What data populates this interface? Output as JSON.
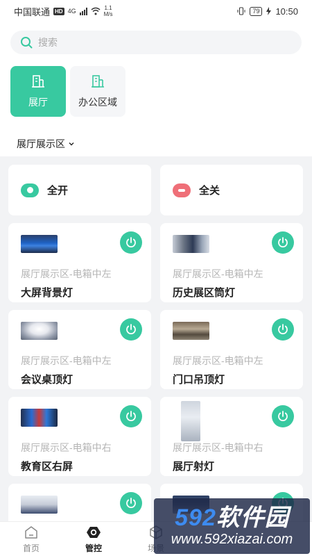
{
  "status_bar": {
    "carrier": "中国联通",
    "network_badge": "HD",
    "net_type": "4G",
    "speed_value": "1.1",
    "speed_unit": "M/s",
    "battery": "79",
    "time": "10:50"
  },
  "search": {
    "placeholder": "搜索",
    "icon": "search-icon"
  },
  "areas": [
    {
      "label": "展厅",
      "icon": "building-icon",
      "active": true
    },
    {
      "label": "办公区域",
      "icon": "building-icon",
      "active": false
    }
  ],
  "zone_selector": {
    "label": "展厅展示区",
    "icon": "chevron-down-icon"
  },
  "quick_actions": {
    "all_on": "全开",
    "all_off": "全关"
  },
  "devices": [
    {
      "location": "展厅展示区-电箱中左",
      "name": "大屏背景灯"
    },
    {
      "location": "展厅展示区-电箱中左",
      "name": "历史展区筒灯"
    },
    {
      "location": "展厅展示区-电箱中左",
      "name": "会议桌顶灯"
    },
    {
      "location": "展厅展示区-电箱中左",
      "name": "门口吊顶灯"
    },
    {
      "location": "展厅展示区-电箱中右",
      "name": "教育区右屏"
    },
    {
      "location": "展厅展示区-电箱中右",
      "name": "展厅射灯"
    },
    {
      "location": "",
      "name": ""
    },
    {
      "location": "",
      "name": ""
    }
  ],
  "bottom_nav": [
    {
      "label": "首页",
      "icon": "home-icon",
      "active": false
    },
    {
      "label": "管控",
      "icon": "control-icon",
      "active": true
    },
    {
      "label": "场景",
      "icon": "scene-icon",
      "active": false
    }
  ],
  "watermark": {
    "brand_digits": "592",
    "brand_text": "软件园",
    "url": "www.592xiazai.com"
  },
  "colors": {
    "accent": "#38c9a0",
    "off": "#ef6f78",
    "background": "#f2f3f5"
  }
}
